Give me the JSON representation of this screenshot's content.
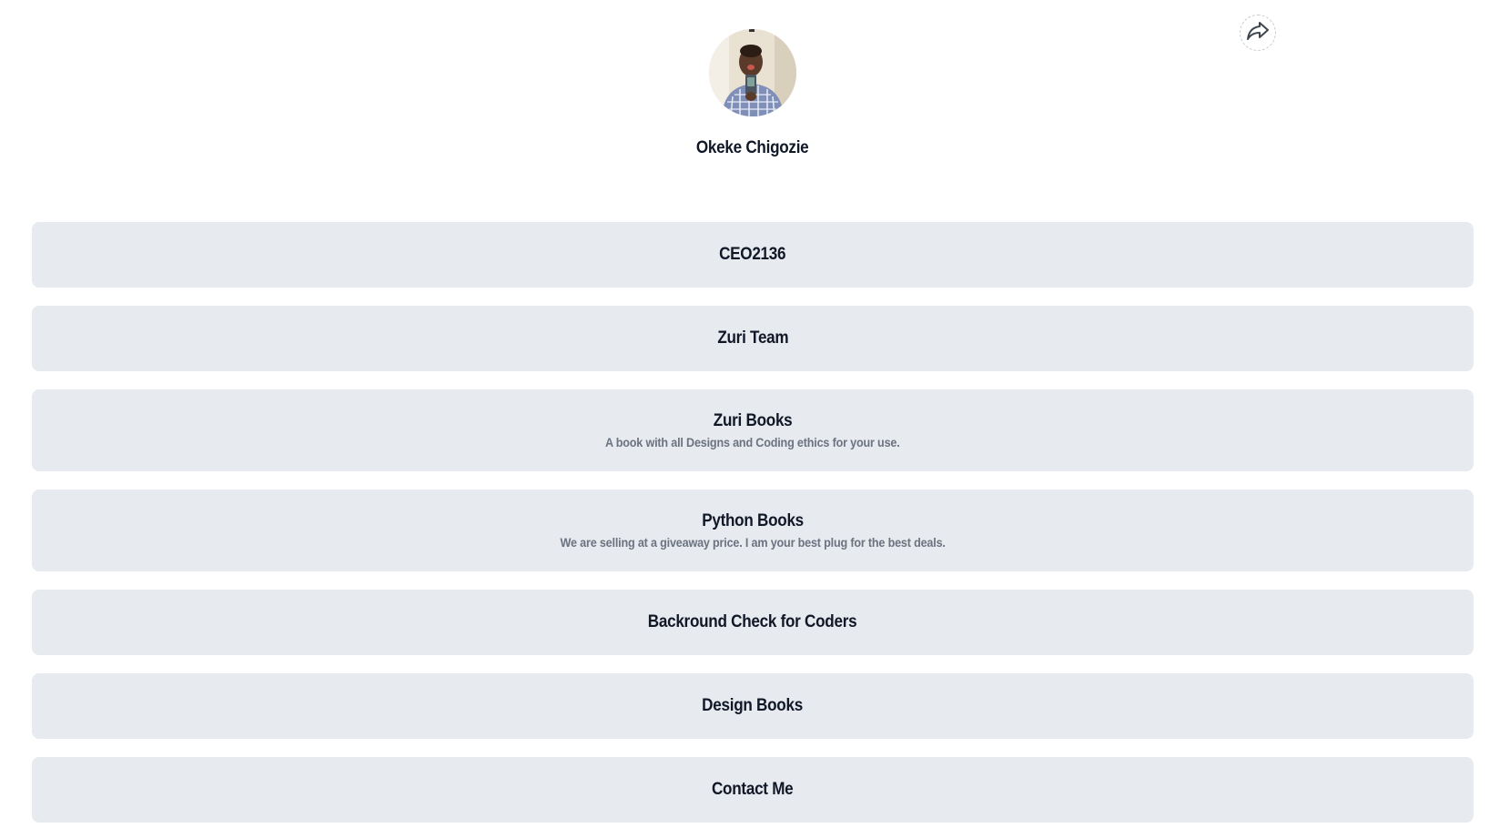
{
  "profile": {
    "name": "Okeke Chigozie"
  },
  "share": {
    "icon": "share-icon"
  },
  "links": [
    {
      "title": "CEO2136",
      "subtitle": ""
    },
    {
      "title": "Zuri Team",
      "subtitle": ""
    },
    {
      "title": "Zuri Books",
      "subtitle": "A book with all Designs and Coding ethics for your use."
    },
    {
      "title": "Python Books",
      "subtitle": "We are selling at a giveaway price. I am your best plug for the best deals."
    },
    {
      "title": "Backround Check for Coders",
      "subtitle": ""
    },
    {
      "title": "Design Books",
      "subtitle": ""
    },
    {
      "title": "Contact Me",
      "subtitle": ""
    }
  ],
  "colors": {
    "link_background": "#e7eaee",
    "text": "#101828",
    "subtext": "#6b7280"
  }
}
